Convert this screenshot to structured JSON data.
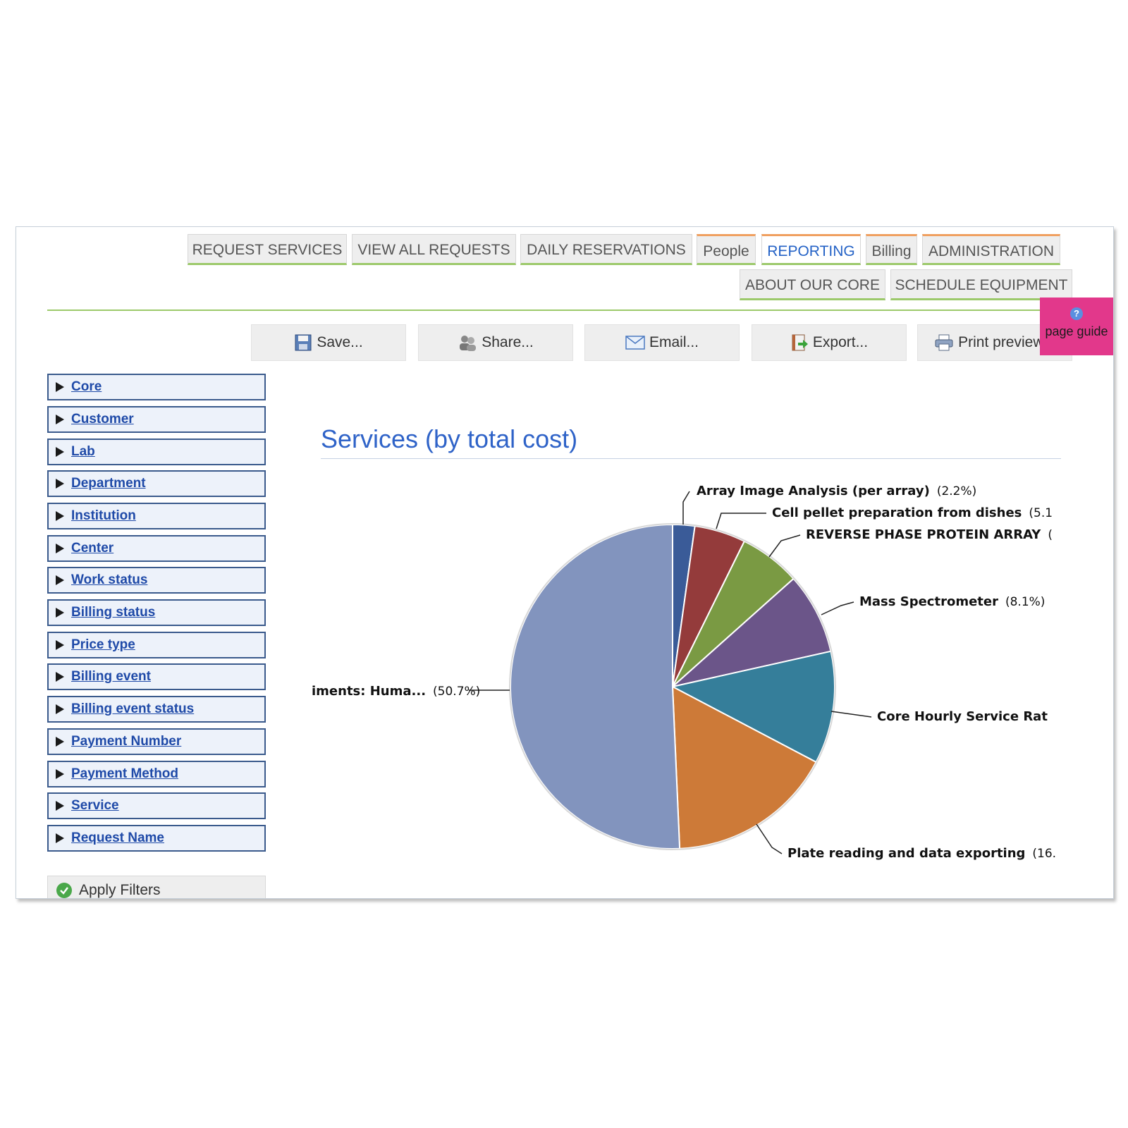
{
  "nav": {
    "tabs": [
      {
        "label": "REQUEST SERVICES"
      },
      {
        "label": "VIEW ALL REQUESTS"
      },
      {
        "label": "DAILY RESERVATIONS"
      },
      {
        "label": "People"
      },
      {
        "label": "REPORTING"
      },
      {
        "label": "Billing"
      },
      {
        "label": "ADMINISTRATION"
      },
      {
        "label": "ABOUT OUR CORE"
      },
      {
        "label": "SCHEDULE EQUIPMENT"
      }
    ],
    "active_tab": "REPORTING"
  },
  "toolbar": {
    "save": "Save...",
    "share": "Share...",
    "email": "Email...",
    "export": "Export...",
    "print": "Print preview..."
  },
  "page_guide": {
    "label": "page guide",
    "icon": "help-icon"
  },
  "filters": {
    "items": [
      "Core",
      "Customer",
      "Lab",
      "Department",
      "Institution",
      "Center",
      "Work status",
      "Billing status",
      "Price type",
      "Billing event",
      "Billing event status",
      "Payment Number",
      "Payment Method",
      "Service",
      "Request Name"
    ],
    "apply": "Apply Filters"
  },
  "colors": {
    "accent_blue": "#2f63c8",
    "tab_active_border": "#f0a060",
    "green_rule": "#9cc96b",
    "page_guide": "#e2388b"
  },
  "chart_data": {
    "type": "pie",
    "title": "Services (by total cost)",
    "slices": [
      {
        "name": "Array Image Analysis (per array)",
        "pct_label": "(2.2%)",
        "value": 2.2,
        "color": "#3a5b98"
      },
      {
        "name": "Cell pellet preparation from dishes",
        "pct_label": "(5.1",
        "value": 5.1,
        "color": "#943b3b"
      },
      {
        "name": "REVERSE PHASE PROTEIN ARRAY",
        "pct_label": "(",
        "value": 6.1,
        "color": "#7a9a43"
      },
      {
        "name": "Mass Spectrometer",
        "pct_label": "(8.1%)",
        "value": 8.1,
        "color": "#6b5589"
      },
      {
        "name": "Core Hourly Service Rat",
        "pct_label": "",
        "value": 11.2,
        "color": "#357e9a"
      },
      {
        "name": "Plate reading and data exporting",
        "pct_label": "(16.",
        "value": 16.6,
        "color": "#cd7a38"
      },
      {
        "name": "iments: Huma...",
        "pct_label": "(50.7%)",
        "value": 50.7,
        "color": "#8294be"
      }
    ]
  }
}
